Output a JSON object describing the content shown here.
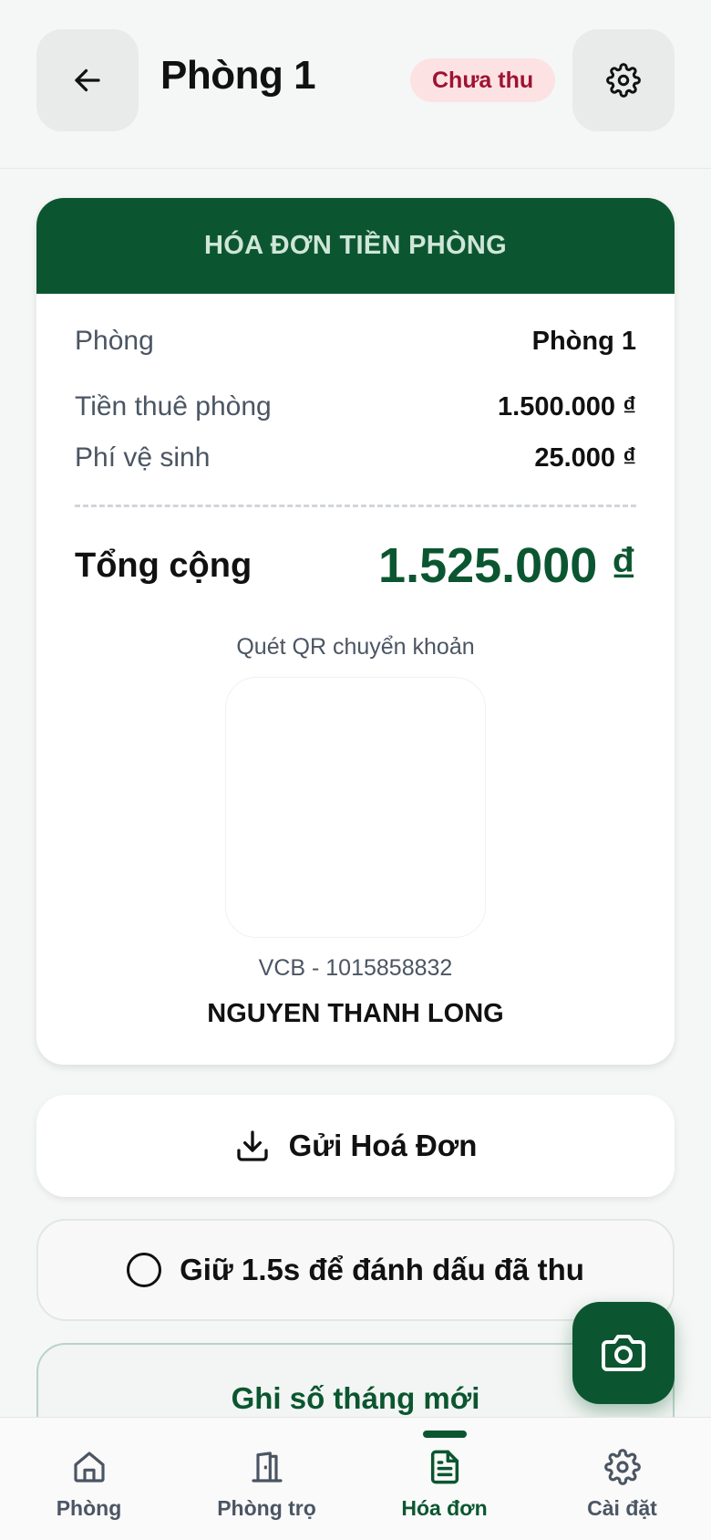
{
  "header": {
    "title": "Phòng 1",
    "status": "Chưa thu",
    "back_icon": "arrow-left-icon",
    "settings_icon": "gear-icon"
  },
  "invoice": {
    "heading": "HÓA ĐƠN TIỀN PHÒNG",
    "room_label": "Phòng",
    "room_value": "Phòng 1",
    "rent_label": "Tiền thuê phòng",
    "rent_value": "1.500.000 ₫",
    "cleaning_label": "Phí vệ sinh",
    "cleaning_value": "25.000 ₫",
    "total_label": "Tổng cộng",
    "total_value": "1.525.000 ₫",
    "qr_caption": "Quét QR chuyển khoản",
    "account": "VCB - 1015858832",
    "owner": "NGUYEN THANH LONG"
  },
  "actions": {
    "send_label": "Gửi Hoá Đơn",
    "hold_label": "Giữ 1.5s để đánh dấu đã thu",
    "new_book_label": "Ghi số tháng mới"
  },
  "fab": {
    "icon": "camera-icon"
  },
  "nav": {
    "items": [
      {
        "label": "Phòng",
        "icon": "home-icon",
        "active": false
      },
      {
        "label": "Phòng trọ",
        "icon": "door-icon",
        "active": false
      },
      {
        "label": "Hóa đơn",
        "icon": "document-icon",
        "active": true
      },
      {
        "label": "Cài đặt",
        "icon": "gear-icon",
        "active": false
      }
    ]
  },
  "colors": {
    "brand": "#0b5630",
    "status_bg": "#fde2e4",
    "status_text": "#9f1232"
  }
}
